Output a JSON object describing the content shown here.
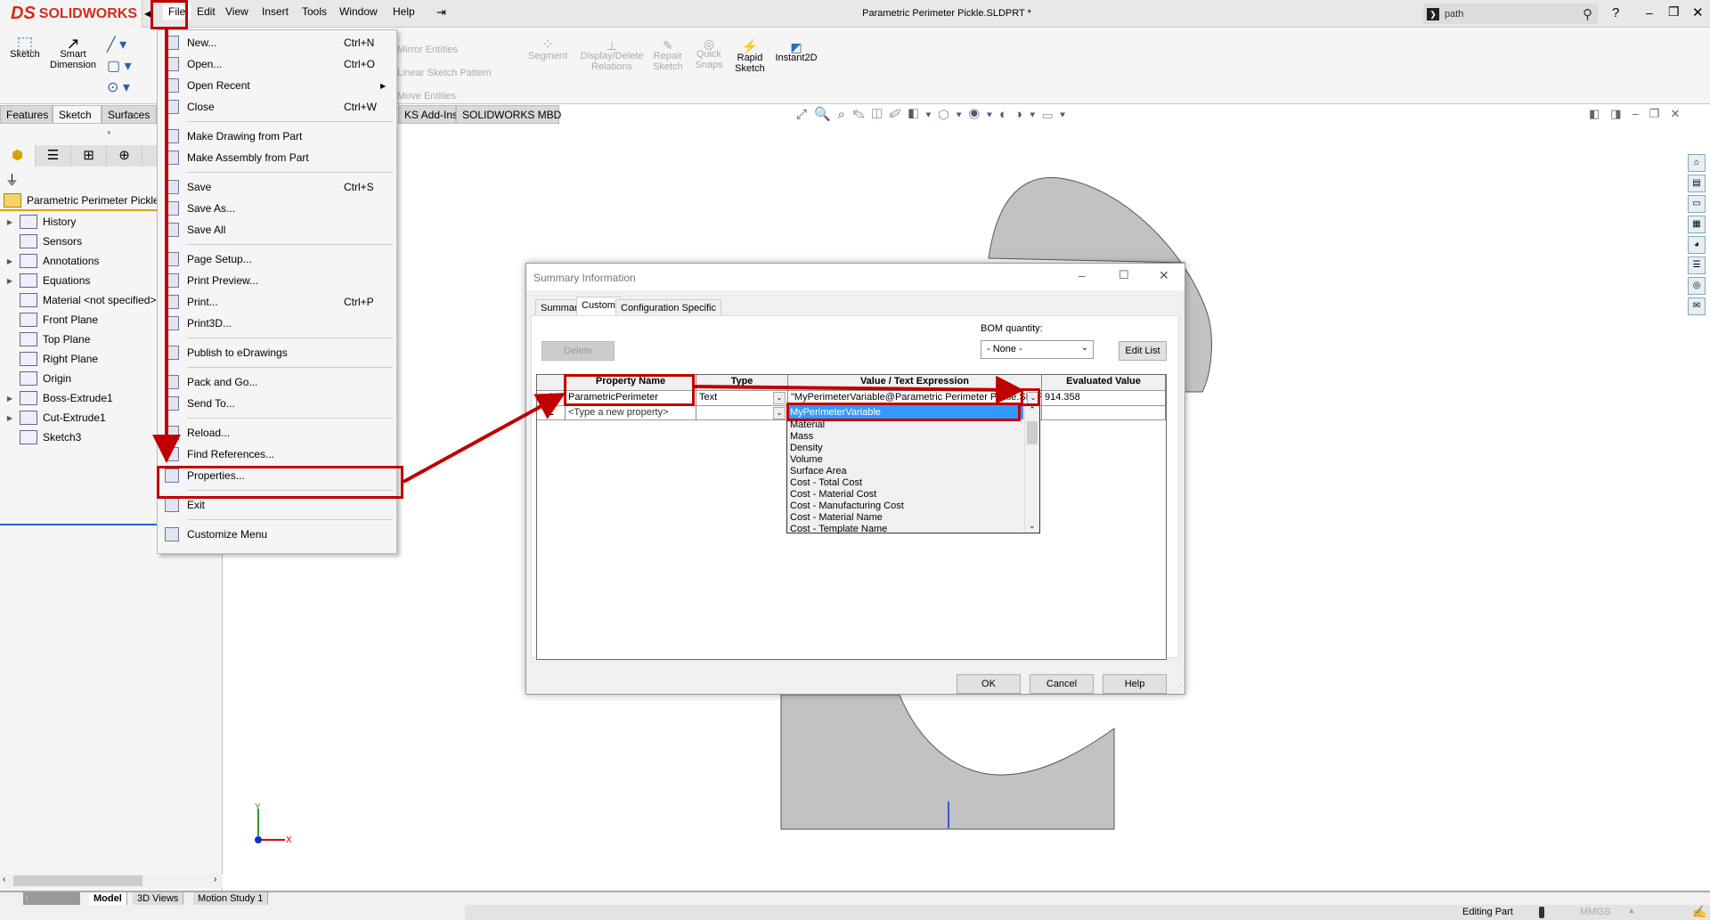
{
  "app": {
    "logo_text": "SOLIDWORKS",
    "title": "Parametric Perimeter Pickle.SLDPRT *",
    "search_placeholder": "path",
    "help": "?"
  },
  "menu": [
    "File",
    "Edit",
    "View",
    "Insert",
    "Tools",
    "Window",
    "Help"
  ],
  "command_manager": {
    "sketch": "Sketch",
    "smart_dimension": "Smart Dimension",
    "mirror": "Mirror Entities",
    "linear_pattern": "Linear Sketch Pattern",
    "move": "Move Entities",
    "segment": "Segment",
    "display_delete": "Display/Delete Relations",
    "repair": "Repair Sketch",
    "quick_snaps": "Quick Snaps",
    "rapid_sketch": "Rapid Sketch",
    "instant2d": "Instant2D"
  },
  "cmd_tabs": [
    "Features",
    "Sketch",
    "Surfaces",
    "KS Add-Ins",
    "SOLIDWORKS MBD"
  ],
  "tree": {
    "root": "Parametric Perimeter Pickle",
    "items": [
      {
        "label": "History",
        "exp": true
      },
      {
        "label": "Sensors",
        "exp": false
      },
      {
        "label": "Annotations",
        "exp": true
      },
      {
        "label": "Equations",
        "exp": true
      },
      {
        "label": "Material <not specified>",
        "exp": false
      },
      {
        "label": "Front Plane",
        "exp": false
      },
      {
        "label": "Top Plane",
        "exp": false
      },
      {
        "label": "Right Plane",
        "exp": false
      },
      {
        "label": "Origin",
        "exp": false
      },
      {
        "label": "Boss-Extrude1",
        "exp": true
      },
      {
        "label": "Cut-Extrude1",
        "exp": true
      },
      {
        "label": "Sketch3",
        "exp": false
      }
    ]
  },
  "file_menu": [
    {
      "label": "New...",
      "shortcut": "Ctrl+N"
    },
    {
      "label": "Open...",
      "shortcut": "Ctrl+O"
    },
    {
      "label": "Open Recent",
      "submenu": true
    },
    {
      "label": "Close",
      "shortcut": "Ctrl+W"
    },
    {
      "sep": true
    },
    {
      "label": "Make Drawing from Part"
    },
    {
      "label": "Make Assembly from Part"
    },
    {
      "sep": true
    },
    {
      "label": "Save",
      "shortcut": "Ctrl+S"
    },
    {
      "label": "Save As..."
    },
    {
      "label": "Save All"
    },
    {
      "sep": true
    },
    {
      "label": "Page Setup..."
    },
    {
      "label": "Print Preview..."
    },
    {
      "label": "Print...",
      "shortcut": "Ctrl+P"
    },
    {
      "label": "Print3D..."
    },
    {
      "sep": true
    },
    {
      "label": "Publish to eDrawings"
    },
    {
      "sep": true
    },
    {
      "label": "Pack and Go..."
    },
    {
      "label": "Send To..."
    },
    {
      "sep": true
    },
    {
      "label": "Reload..."
    },
    {
      "label": "Find References..."
    },
    {
      "label": "Properties..."
    },
    {
      "sep": true
    },
    {
      "label": "Exit"
    },
    {
      "sep": true
    },
    {
      "label": "Customize Menu"
    }
  ],
  "dialog": {
    "title": "Summary Information",
    "tabs": [
      "Summary",
      "Custom",
      "Configuration Specific"
    ],
    "active_tab": "Custom",
    "delete": "Delete",
    "bom_label": "BOM quantity:",
    "bom_value": "- None -",
    "edit_list": "Edit List",
    "columns": [
      "",
      "Property Name",
      "Type",
      "Value / Text Expression",
      "Evaluated Value"
    ],
    "rows": [
      {
        "num": "1",
        "name": "ParametricPerimeter",
        "type": "Text",
        "value": "\"MyPerimeterVariable@Parametric Perimeter Pickle.SLDPRT\"",
        "evaluated": "914.358"
      },
      {
        "num": "2",
        "name": "<Type a new property>",
        "type": "",
        "value": "",
        "evaluated": ""
      }
    ],
    "dropdown": [
      "MyPerimeterVariable",
      "Material",
      "Mass",
      "Density",
      "Volume",
      "Surface Area",
      "Cost - Total Cost",
      "Cost - Material Cost",
      "Cost - Manufacturing Cost",
      "Cost - Material Name",
      "Cost - Template Name"
    ],
    "selected": "MyPerimeterVariable",
    "ok": "OK",
    "cancel": "Cancel",
    "help": "Help"
  },
  "triad": {
    "x": "X",
    "y": "Y"
  },
  "bottom_tabs": [
    "Model",
    "3D Views",
    "Motion Study 1"
  ],
  "status": {
    "mode": "Editing Part",
    "units": "MMGS"
  },
  "colors": {
    "annotation_red": "#c00000",
    "selection_blue": "#3399ff",
    "brand_red": "#d52b1e"
  }
}
